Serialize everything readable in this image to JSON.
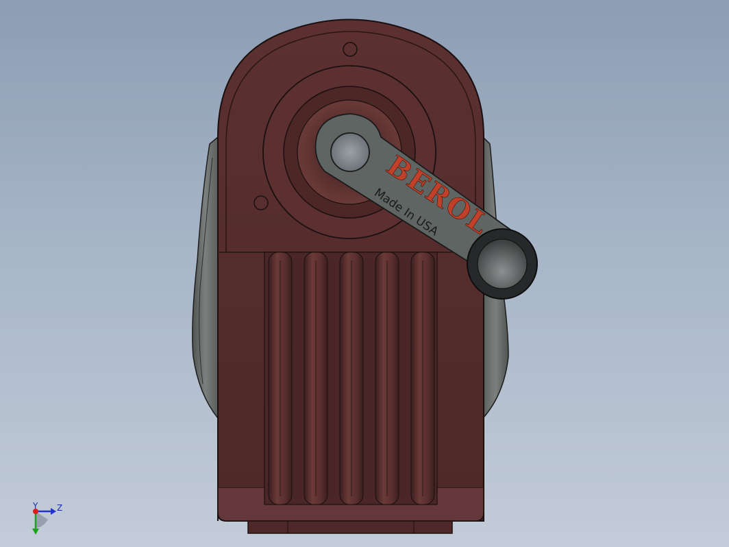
{
  "viewport": {
    "background_top": "#8c9db4",
    "background_bottom": "#c3ccd8"
  },
  "model": {
    "body_color": "#5a2f2f",
    "side_color": "#6e7370",
    "crank_color": "#5f6563",
    "handle_color": "#27292b",
    "brand_text": "BEROL",
    "brand_color": "#c0402a",
    "made_in_text": "Made In USA"
  },
  "triad": {
    "y_label": "Y",
    "z_label": "Z",
    "x_color": "#d9201e",
    "y_color": "#1fa01f",
    "z_color": "#2430d0"
  }
}
